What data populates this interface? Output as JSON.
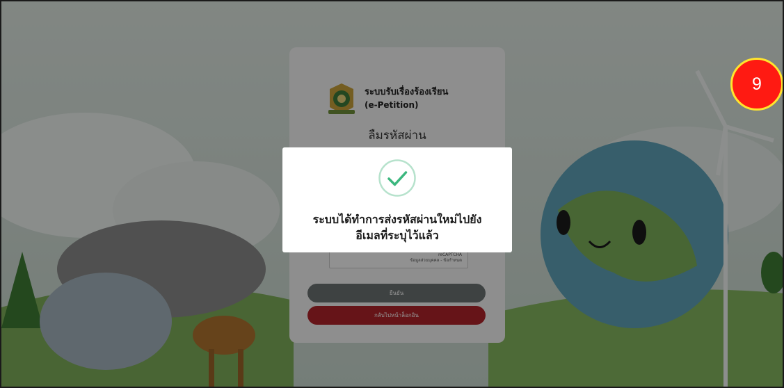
{
  "card": {
    "system_name": "ระบบรับเรื่องร้องเรียน",
    "system_sub": "(e-Petition)",
    "title": "ลืมรหัสผ่าน",
    "captcha_brand": "reCAPTCHA",
    "captcha_terms": "ข้อมูลส่วนบุคคล - ข้อกำหนด",
    "confirm_label": "ยืนยัน",
    "back_label": "กลับไปหน้าล็อกอิน"
  },
  "modal": {
    "icon": "check-circle-icon",
    "message_line1": "ระบบได้ทำการส่งรหัสผ่านใหม่ไปยัง",
    "message_line2": "อีเมลที่ระบุไว้แล้ว"
  },
  "step_badge": "9",
  "colors": {
    "confirm_button": "#6b7272",
    "back_button": "#b0232a",
    "success_green": "#3bb77e",
    "badge_red": "#ff1a12",
    "badge_ring": "#ffe52e"
  }
}
